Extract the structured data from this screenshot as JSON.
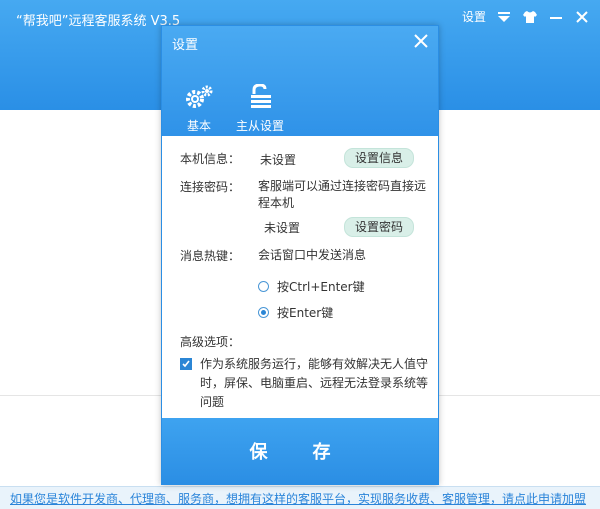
{
  "main": {
    "title": "“帮我吧”远程客服系统 V3.5",
    "settings_link": "设置",
    "bottom_link": "如果您是软件开发商、代理商、服务商，想拥有这样的客服平台，实现服务收费、客服管理，请点此申请加盟"
  },
  "dialog": {
    "title": "设置",
    "tabs": [
      {
        "label": "基本",
        "icon": "gears-icon"
      },
      {
        "label": "主从设置",
        "icon": "unlock-icon"
      }
    ],
    "machine_info": {
      "label": "本机信息：",
      "value": "未设置",
      "button": "设置信息"
    },
    "connect_password": {
      "label": "连接密码：",
      "description": "客服端可以通过连接密码直接远程本机",
      "value": "未设置",
      "button": "设置密码"
    },
    "hotkey": {
      "label": "消息热键：",
      "description": "会话窗口中发送消息",
      "options": [
        {
          "label": "按Ctrl+Enter键",
          "selected": false
        },
        {
          "label": "按Enter键",
          "selected": true
        }
      ]
    },
    "advanced": {
      "label": "高级选项：",
      "service_option": "作为系统服务运行，能够有效解决无人值守时，屏保、电脑重启、远程无法登录系统等问题",
      "service_checked": true
    },
    "save_label": "保 存"
  },
  "colors": {
    "accent": "#2b8ee4",
    "pill": "#d9efe8",
    "link": "#2a84d9"
  }
}
